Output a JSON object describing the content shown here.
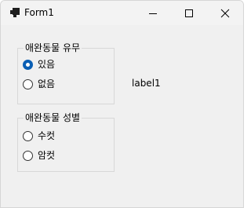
{
  "window": {
    "title": "Form1"
  },
  "pet_presence_group": {
    "title": "애완동물 유무",
    "options": [
      {
        "label": "있음",
        "checked": true
      },
      {
        "label": "없음",
        "checked": false
      }
    ]
  },
  "pet_gender_group": {
    "title": "애완동물 성별",
    "options": [
      {
        "label": "수컷",
        "checked": false
      },
      {
        "label": "암컷",
        "checked": false
      }
    ]
  },
  "label1": "label1",
  "colors": {
    "radio_checked": "#0a5fb4",
    "window_bg": "#f0f0f0",
    "group_border": "#d8d8d8"
  }
}
